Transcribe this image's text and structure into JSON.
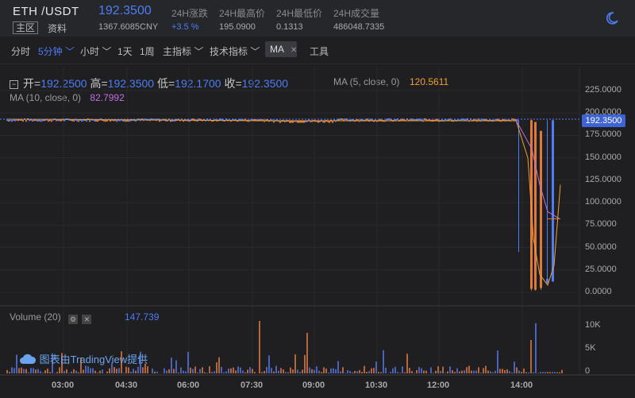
{
  "header": {
    "pair": "ETH /USDT",
    "last_price": "192.3500",
    "tab_main": "主区",
    "tab_info": "资料",
    "cny_price": "1367.6085CNY",
    "stats": [
      {
        "label": "24H涨跌",
        "value": "+3.5 %"
      },
      {
        "label": "24H最高价",
        "value": "195.0900"
      },
      {
        "label": "24H最低价",
        "value": "0.1313"
      },
      {
        "label": "24H成交量",
        "value": "486048.7335"
      }
    ]
  },
  "toolbar": {
    "items": [
      "分时",
      "5分钟",
      "小时",
      "1天",
      "1周",
      "主指标",
      "技术指标",
      "MA",
      "工具"
    ]
  },
  "legend": {
    "open_label": "开=",
    "open": "192.2500",
    "high_label": "高=",
    "high": "192.3500",
    "low_label": "低=",
    "low": "192.1700",
    "close_label": "收=",
    "close": "192.3500",
    "ma5_label": "MA (5, close, 0)",
    "ma5": "120.5611",
    "ma10_label": "MA (10, close, 0)",
    "ma10": "82.7992",
    "volume_label": "Volume (20)",
    "volume": "147.739"
  },
  "watermark": "图表由TradingView提供",
  "colors": {
    "up": "#4d7cf5",
    "down": "#e07a3a",
    "ma5": "#f0a030",
    "ma10": "#c06fe0",
    "bg": "#1f1f21"
  },
  "chart_data": {
    "type": "candlestick",
    "y_ticks": [
      "225.0000",
      "200.0000",
      "175.0000",
      "150.0000",
      "125.0000",
      "100.0000",
      "75.0000",
      "50.0000",
      "25.0000",
      "0.0000"
    ],
    "y_range": [
      0,
      225
    ],
    "volume_ticks": [
      "10K",
      "5K",
      "0"
    ],
    "x_ticks": [
      "03:00",
      "04:30",
      "06:00",
      "07:30",
      "09:00",
      "10:30",
      "12:00",
      "14:00"
    ],
    "current_price": "192.3500",
    "crash_candles": [
      {
        "o": 192,
        "h": 192,
        "l": 45,
        "c": 192,
        "dir": "up"
      },
      {
        "o": 192,
        "h": 192,
        "l": 2,
        "c": 4,
        "dir": "down"
      },
      {
        "o": 190,
        "h": 190,
        "l": 2,
        "c": 3,
        "dir": "down"
      },
      {
        "o": 180,
        "h": 180,
        "l": 3,
        "c": 5,
        "dir": "down"
      },
      {
        "o": 10,
        "h": 192,
        "l": 10,
        "c": 15,
        "dir": "up"
      },
      {
        "o": 12,
        "h": 192,
        "l": 12,
        "c": 192,
        "dir": "up"
      }
    ]
  }
}
